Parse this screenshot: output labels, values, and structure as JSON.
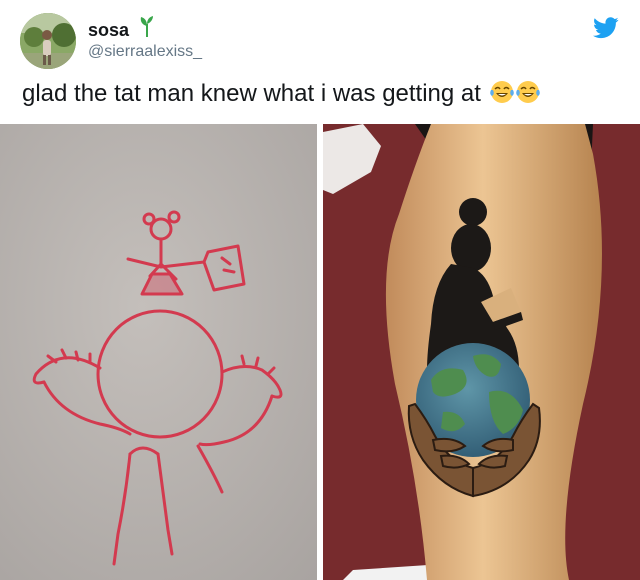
{
  "tweet": {
    "display_name": "sosa",
    "handle": "@sierraalexiss_",
    "text": "glad the tat man knew what i was getting at",
    "emojis": [
      "face-with-tears-of-joy",
      "face-with-tears-of-joy"
    ]
  },
  "icons": {
    "brand": "twitter-bird-icon",
    "name_badge": "sprout-icon"
  },
  "colors": {
    "twitter_blue": "#1da1f2",
    "handle_gray": "#657786",
    "drawing_red": "#d33a4f"
  },
  "media": [
    {
      "description_name": "child-drawing-photo"
    },
    {
      "description_name": "tattoo-photo"
    }
  ]
}
